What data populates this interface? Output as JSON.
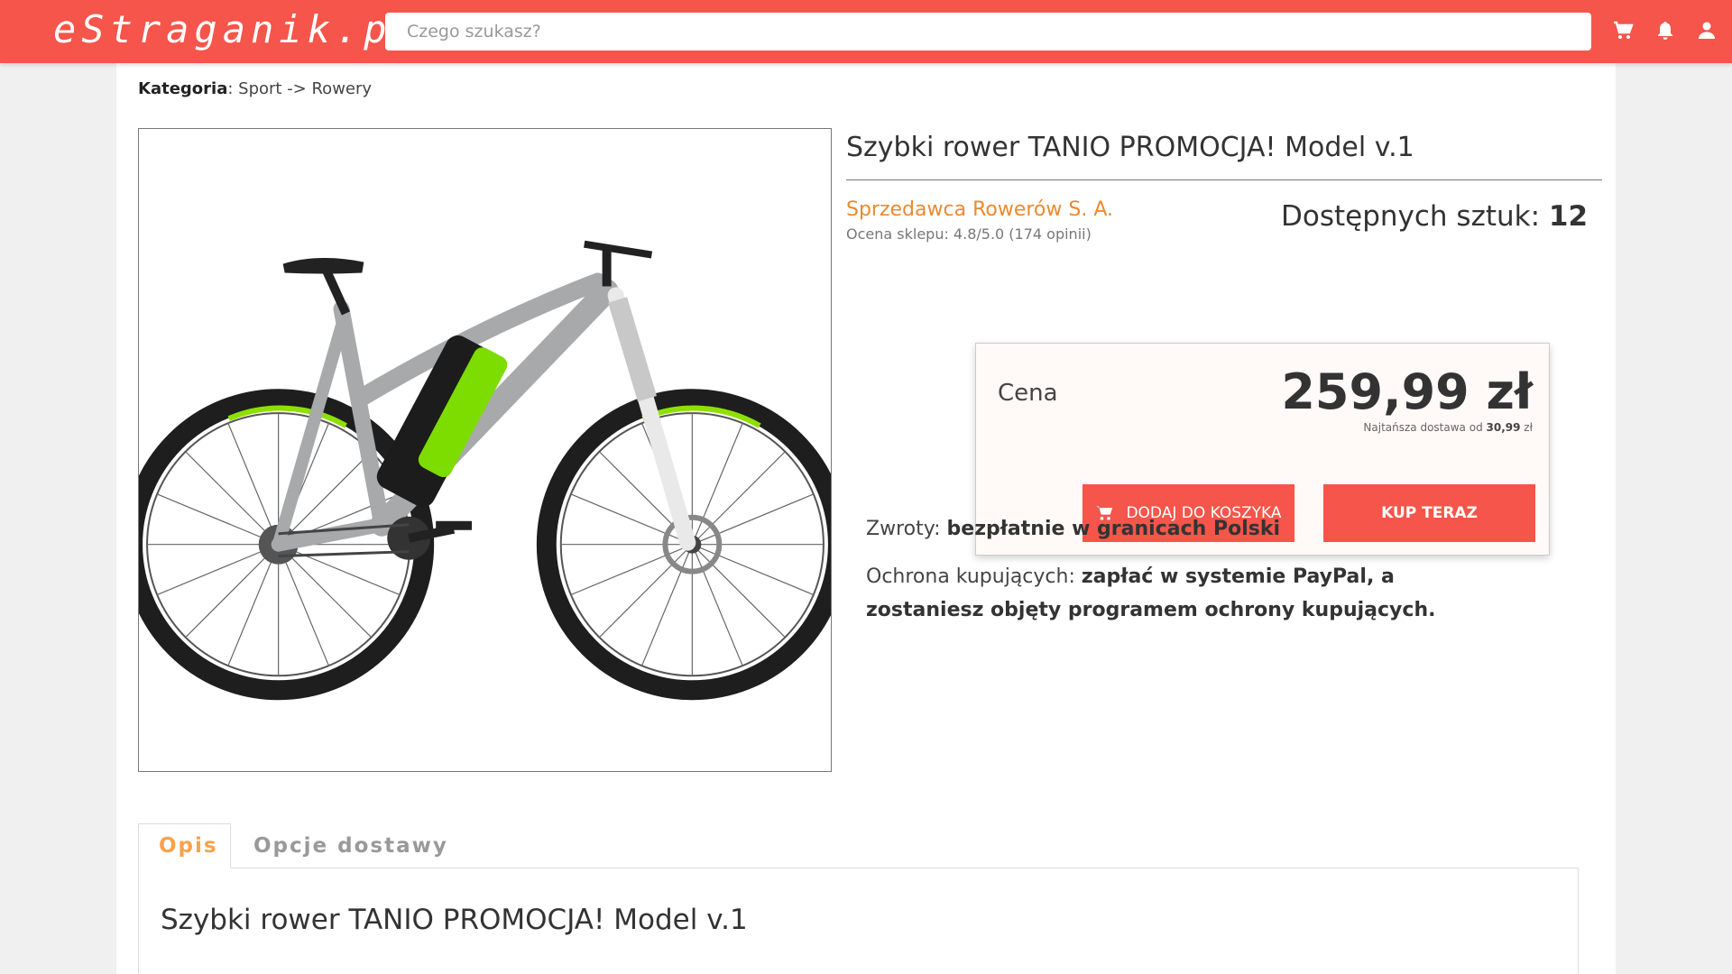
{
  "header": {
    "logo": "eStraganik.pl",
    "search_placeholder": "Czego szukasz?",
    "icons": [
      "cart-icon",
      "bell-icon",
      "user-icon"
    ]
  },
  "breadcrumb": {
    "label": "Kategoria",
    "path": ": Sport -> Rowery"
  },
  "product": {
    "title": "Szybki rower TANIO PROMOCJA! Model v.1",
    "seller": "Sprzedawca Rowerów S. A.",
    "rating": "Ocena sklepu: 4.8/5.0 (174 opinii)",
    "stock_label": "Dostępnych sztuk: ",
    "stock_value": "12"
  },
  "price_box": {
    "label": "Cena",
    "price": "259,99 zł",
    "shipping_prefix": "Najtańsza dostawa od ",
    "shipping_value": "30,99",
    "shipping_suffix": " zł",
    "add_to_cart": "DODAJ DO KOSZYKA",
    "buy_now": "KUP TERAZ"
  },
  "info": {
    "returns_label": "Zwroty: ",
    "returns_value": "bezpłatnie w granicach Polski",
    "protection_label": "Ochrona kupujących: ",
    "protection_value": "zapłać w systemie PayPal, a zostaniesz objęty programem ochrony kupujących."
  },
  "tabs": {
    "description": "Opis",
    "delivery": "Opcje dostawy"
  },
  "description": {
    "title": "Szybki rower TANIO PROMOCJA! Model v.1"
  },
  "colors": {
    "brand": "#f5554a",
    "seller_link": "#ea8a2e",
    "tab_active": "#f7a24b"
  }
}
